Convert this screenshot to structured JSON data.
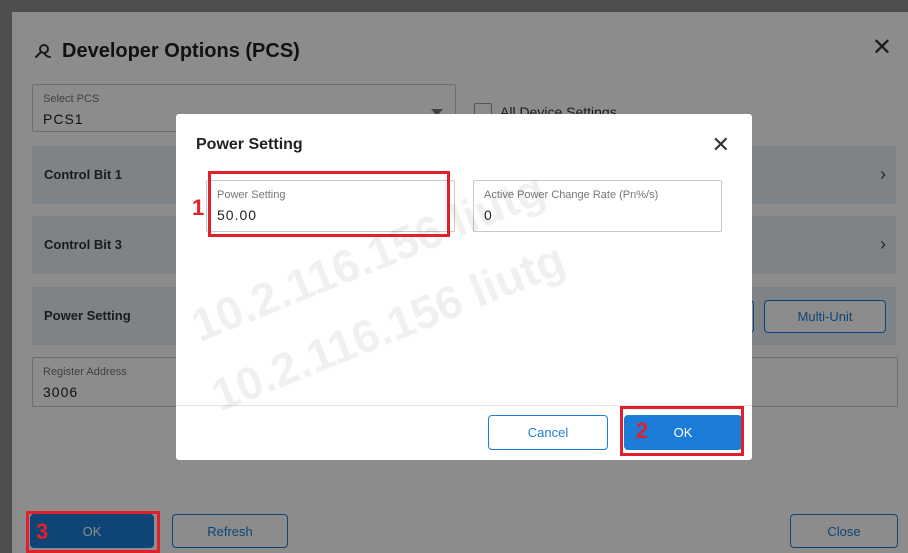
{
  "page": {
    "title": "Developer Options (PCS)",
    "select_pcs": {
      "label": "Select PCS",
      "value": "PCS1"
    },
    "all_device_settings": "All Device Settings",
    "rows": [
      {
        "label": "Control Bit 1"
      },
      {
        "label": "Control Bit 3"
      },
      {
        "label": "Power Setting"
      }
    ],
    "multi_unit": "Multi-Unit",
    "register": {
      "label": "Register Address",
      "value": "3006"
    },
    "buttons": {
      "ok": "OK",
      "refresh": "Refresh",
      "close": "Close"
    }
  },
  "modal": {
    "title": "Power Setting",
    "power_setting": {
      "label": "Power Setting",
      "value": "50.00"
    },
    "active_power_rate": {
      "label": "Active Power Change Rate (Pn%/s)",
      "value": "0"
    },
    "buttons": {
      "cancel": "Cancel",
      "ok": "OK"
    }
  },
  "annotations": {
    "one": "1",
    "two": "2",
    "three": "3"
  },
  "watermark": [
    "10.2.116.156 liutg",
    "10.2.116.156 liutg"
  ],
  "colors": {
    "accent": "#1b7dd8",
    "annotation": "#e0202a",
    "row_bg": "#e6eff7"
  }
}
